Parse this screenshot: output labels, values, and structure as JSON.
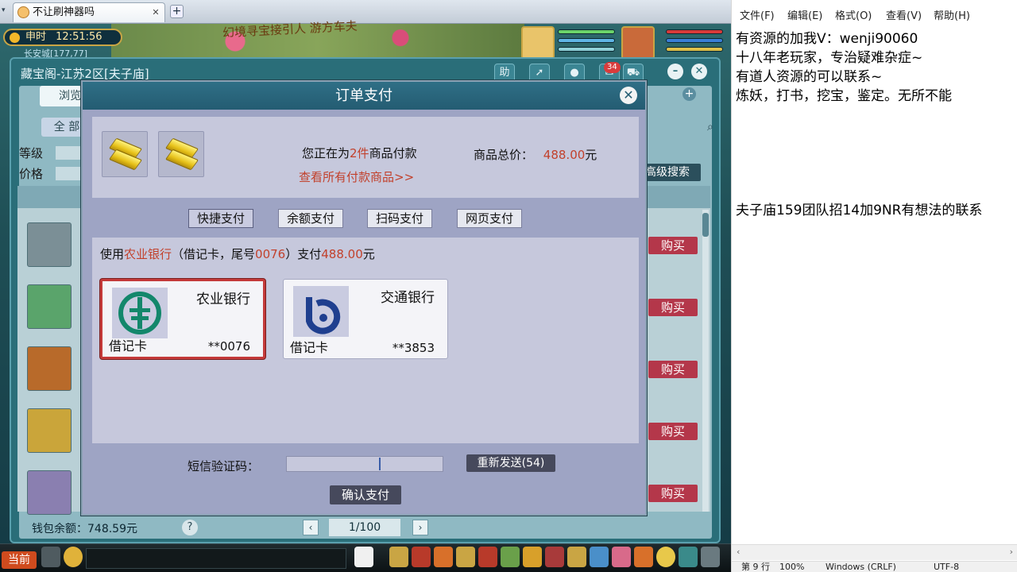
{
  "browser": {
    "tab_title": "不让刷神器吗",
    "close_glyph": "✕",
    "new_tab_glyph": "+"
  },
  "game": {
    "clock_label": "申时",
    "clock_time": "12:51:56",
    "location": "长安城[177,77]",
    "scenery_text": "幻境寻宝接引人 游方车夫"
  },
  "treasure_window": {
    "title": "藏宝阁-江苏2区[夫子庙]",
    "tab_browse": "浏览",
    "tab_all": "全 部",
    "help_icon_label": "助",
    "message_count": "34",
    "filter_level_label": "等级",
    "filter_price_label": "价格",
    "advanced_search_label": "高级搜索",
    "buy_label": "购买",
    "wallet_balance": "钱包余额：748.59元",
    "help_glyph": "?",
    "page_indicator": "1/100",
    "prev_glyph": "‹",
    "next_glyph": "›"
  },
  "dialog": {
    "title": "订单支付",
    "close_glyph": "✕",
    "pay_prefix": "您正在为",
    "pay_count": "2件",
    "pay_suffix": "商品付款",
    "view_all_link": "查看所有付款商品>>",
    "total_label": "商品总价：",
    "total_amount": "488.00",
    "total_unit": "元",
    "methods": [
      "快捷支付",
      "余额支付",
      "扫码支付",
      "网页支付"
    ],
    "use_prefix": "使用",
    "use_bank": "农业银行",
    "use_mid": "（借记卡，尾号",
    "use_tail": "0076",
    "use_pay": "）支付",
    "use_amount": "488.00",
    "use_unit": "元",
    "cards": [
      {
        "bank": "农业银行",
        "type": "借记卡",
        "number": "**0076"
      },
      {
        "bank": "交通银行",
        "type": "借记卡",
        "number": "**3853"
      }
    ],
    "sms_label": "短信验证码：",
    "resend_label": "重新发送(54)",
    "confirm_label": "确认支付"
  },
  "gamebar": {
    "current_channel": "当前"
  },
  "notepad": {
    "menu": [
      "文件(F)",
      "编辑(E)",
      "格式(O)",
      "查看(V)",
      "帮助(H)"
    ],
    "lines": [
      "有资源的加我V：wenji90060",
      "十八年老玩家，专治疑难杂症~",
      "有道人资源的可以联系~",
      "炼妖，打书，挖宝，鉴定。无所不能",
      "夫子庙159团队招14加9NR有想法的联系"
    ],
    "status": {
      "position": "第 9 行",
      "zoom": "100%",
      "eol": "Windows (CRLF)",
      "encoding": "UTF-8"
    }
  },
  "colors": {
    "accent_red": "#c2412c",
    "dialog_header": "#2f6f86",
    "buy_button": "#b4374a"
  }
}
